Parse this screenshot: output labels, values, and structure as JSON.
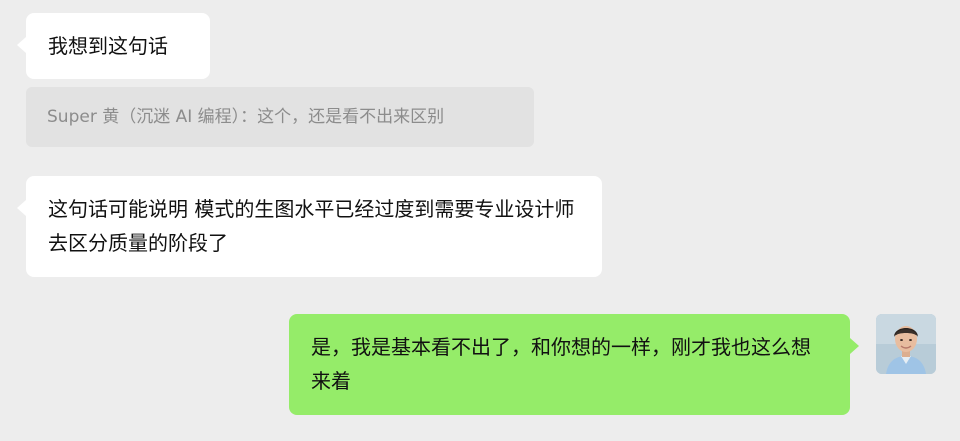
{
  "messages": [
    {
      "side": "left",
      "text": "我想到这句话"
    },
    {
      "side": "left",
      "type": "quote",
      "text": "Super 黄（沉迷 AI 编程）：这个，还是看不出来区别"
    },
    {
      "side": "left",
      "text": "这句话可能说明  模式的生图水平已经过度到需要专业设计师去区分质量的阶段了"
    },
    {
      "side": "right",
      "text": "是，我是基本看不出了，和你想的一样，刚才我也这么想来着"
    }
  ],
  "avatar": {
    "icon": "person-avatar-icon"
  },
  "colors": {
    "background": "#ededed",
    "incoming_bubble": "#ffffff",
    "outgoing_bubble": "#95ec69",
    "quote_bg": "#e2e2e2",
    "quote_text": "#8c8c8c"
  }
}
